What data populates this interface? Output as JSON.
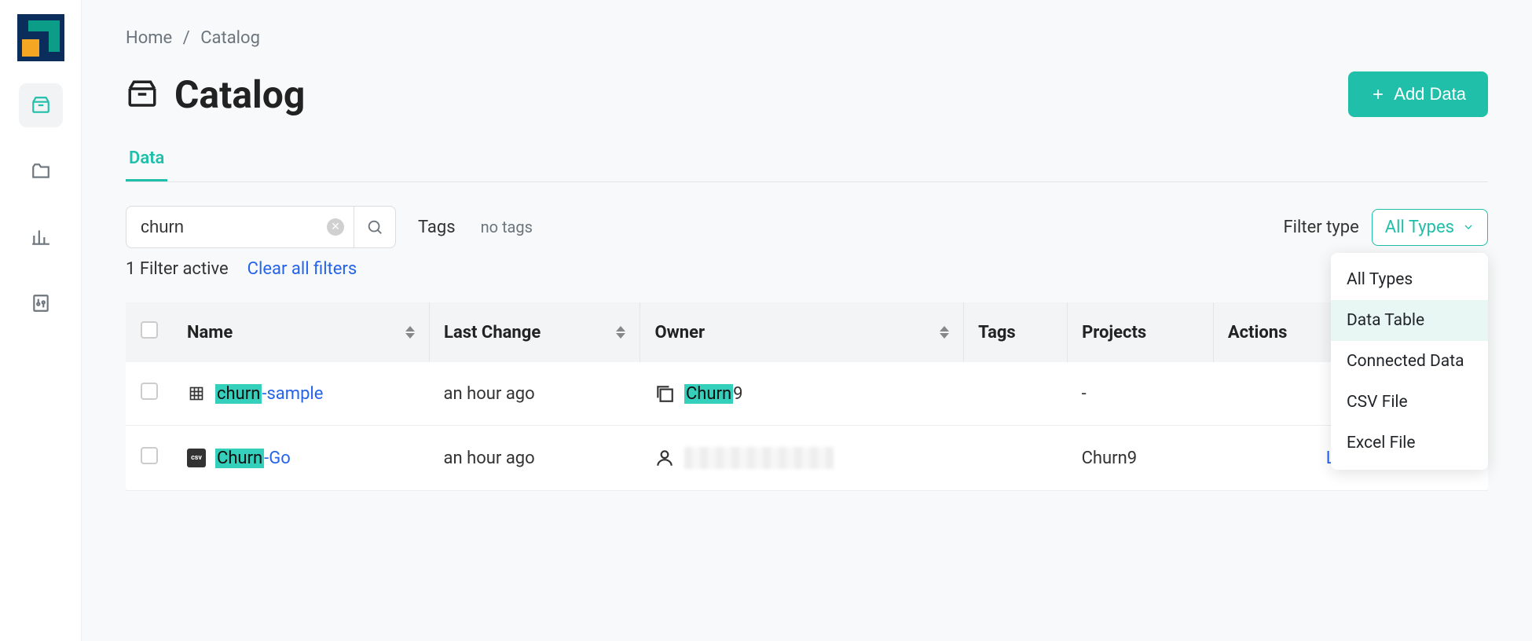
{
  "breadcrumb": {
    "home": "Home",
    "current": "Catalog"
  },
  "page": {
    "title": "Catalog"
  },
  "actions": {
    "addData": "Add Data"
  },
  "tabs": {
    "data": "Data"
  },
  "search": {
    "value": "churn"
  },
  "tags": {
    "label": "Tags",
    "empty": "no tags"
  },
  "filter": {
    "typeLabel": "Filter type",
    "selected": "All Types",
    "activeText": "1 Filter active",
    "clear": "Clear all filters",
    "options": [
      "All Types",
      "Data Table",
      "Connected Data",
      "CSV File",
      "Excel File"
    ]
  },
  "columns": {
    "name": "Name",
    "lastChange": "Last Change",
    "owner": "Owner",
    "tags": "Tags",
    "projects": "Projects",
    "actions": "Actions"
  },
  "rows": [
    {
      "typeIcon": "grid",
      "nameHighlight": "churn",
      "nameRest": "-sample",
      "lastChange": "an hour ago",
      "ownerIcon": "stack",
      "ownerHighlight": "Churn",
      "ownerRest": "9",
      "tags": "",
      "projects": "-",
      "linkAction": "",
      "redactedOwner": false
    },
    {
      "typeIcon": "csv",
      "nameHighlight": "Churn",
      "nameRest": "-Go",
      "lastChange": "an hour ago",
      "ownerIcon": "person",
      "ownerHighlight": "",
      "ownerRest": "",
      "tags": "",
      "projects": "Churn9",
      "linkAction": "Link to Project",
      "redactedOwner": true
    }
  ]
}
